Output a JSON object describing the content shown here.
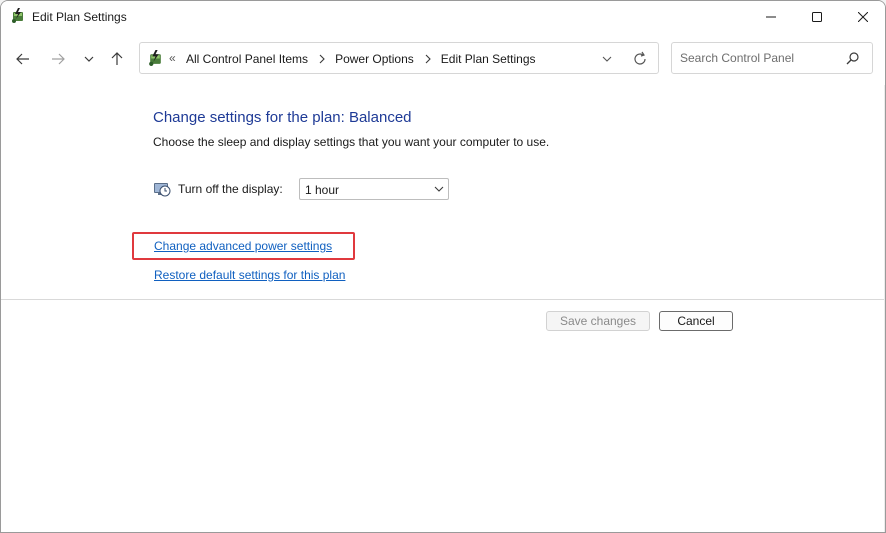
{
  "window": {
    "title": "Edit Plan Settings",
    "title_icon": "power-options-icon",
    "controls": {
      "minimize": "minimize-icon",
      "maximize": "maximize-icon",
      "close": "close-icon"
    }
  },
  "toolbar": {
    "back_icon": "arrow-left-icon",
    "forward_icon": "arrow-right-icon",
    "recent_icon": "chevron-down-icon",
    "up_icon": "arrow-up-icon",
    "address": {
      "overflow": "«",
      "crumbs": [
        "All Control Panel Items",
        "Power Options",
        "Edit Plan Settings"
      ]
    },
    "search": {
      "placeholder": "Search Control Panel",
      "value": ""
    }
  },
  "main": {
    "heading": "Change settings for the plan: Balanced",
    "subtext": "Choose the sleep and display settings that you want your computer to use.",
    "display_setting": {
      "label": "Turn off the display:",
      "value": "1 hour"
    },
    "links": {
      "advanced": "Change advanced power settings",
      "restore": "Restore default settings for this plan"
    },
    "buttons": {
      "save": "Save changes",
      "cancel": "Cancel"
    }
  },
  "colors": {
    "heading": "#1e3a96",
    "link": "#1060c0",
    "highlight": "#e0393e"
  }
}
